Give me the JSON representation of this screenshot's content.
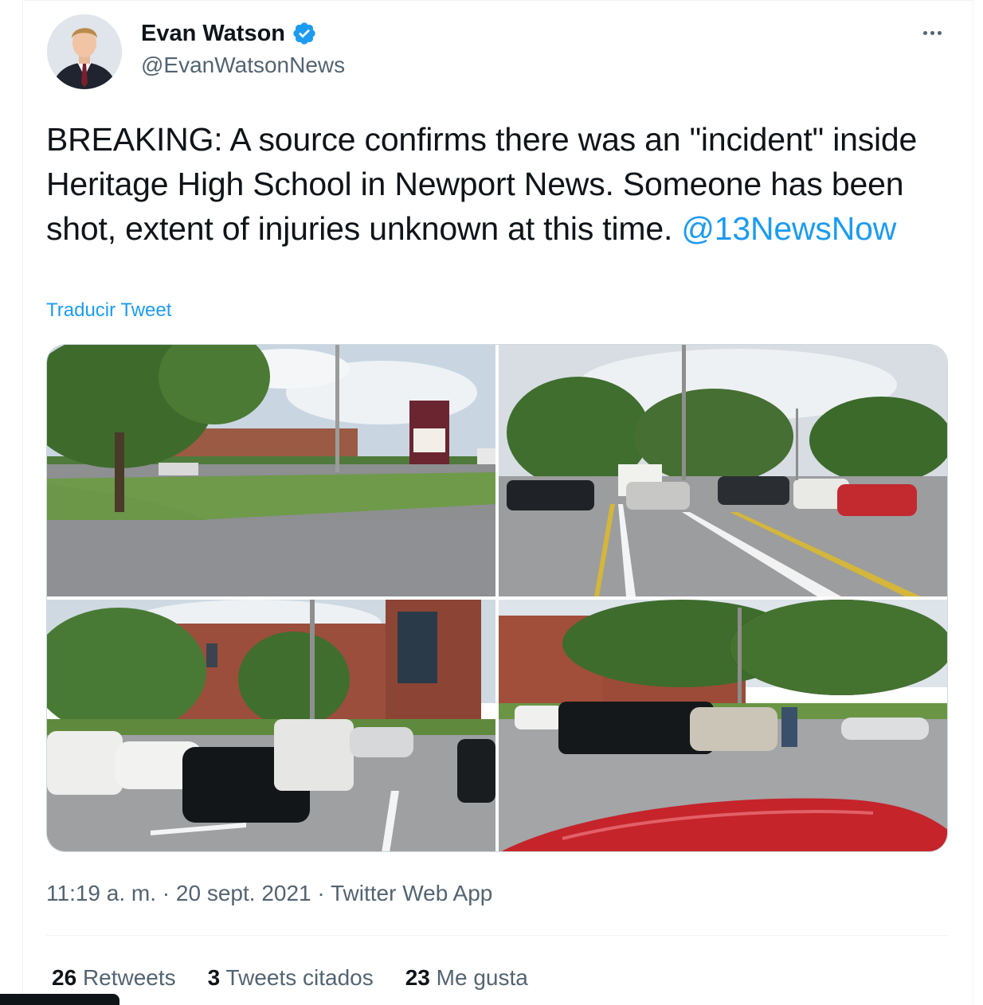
{
  "author": {
    "name": "Evan Watson",
    "handle": "@EvanWatsonNews",
    "verified": true
  },
  "icons": {
    "verified": "verified-badge-icon",
    "more": "more-options-icon"
  },
  "tweet": {
    "text_before_mention": "BREAKING: A source confirms there was an \"incident\" inside Heritage High School in Newport News. Someone has been shot, extent of injuries unknown at this time. ",
    "mention": "@13NewsNow",
    "translate_label": "Traducir Tweet"
  },
  "photos": [
    {
      "description": "school-entrance-sign-photo"
    },
    {
      "description": "parking-lot-ambulance-photo"
    },
    {
      "description": "school-building-parked-cars-photo"
    },
    {
      "description": "police-vehicles-parking-lot-photo"
    }
  ],
  "meta": {
    "time": "11:19 a. m.",
    "separator": " · ",
    "date": "20 sept. 2021",
    "source": "Twitter Web App"
  },
  "stats": {
    "retweets_count": "26",
    "retweets_label": "Retweets",
    "quotes_count": "3",
    "quotes_label": "Tweets citados",
    "likes_count": "23",
    "likes_label": "Me gusta"
  },
  "colors": {
    "accent": "#1d9bf0",
    "text_primary": "#0f1419",
    "text_secondary": "#536471"
  }
}
